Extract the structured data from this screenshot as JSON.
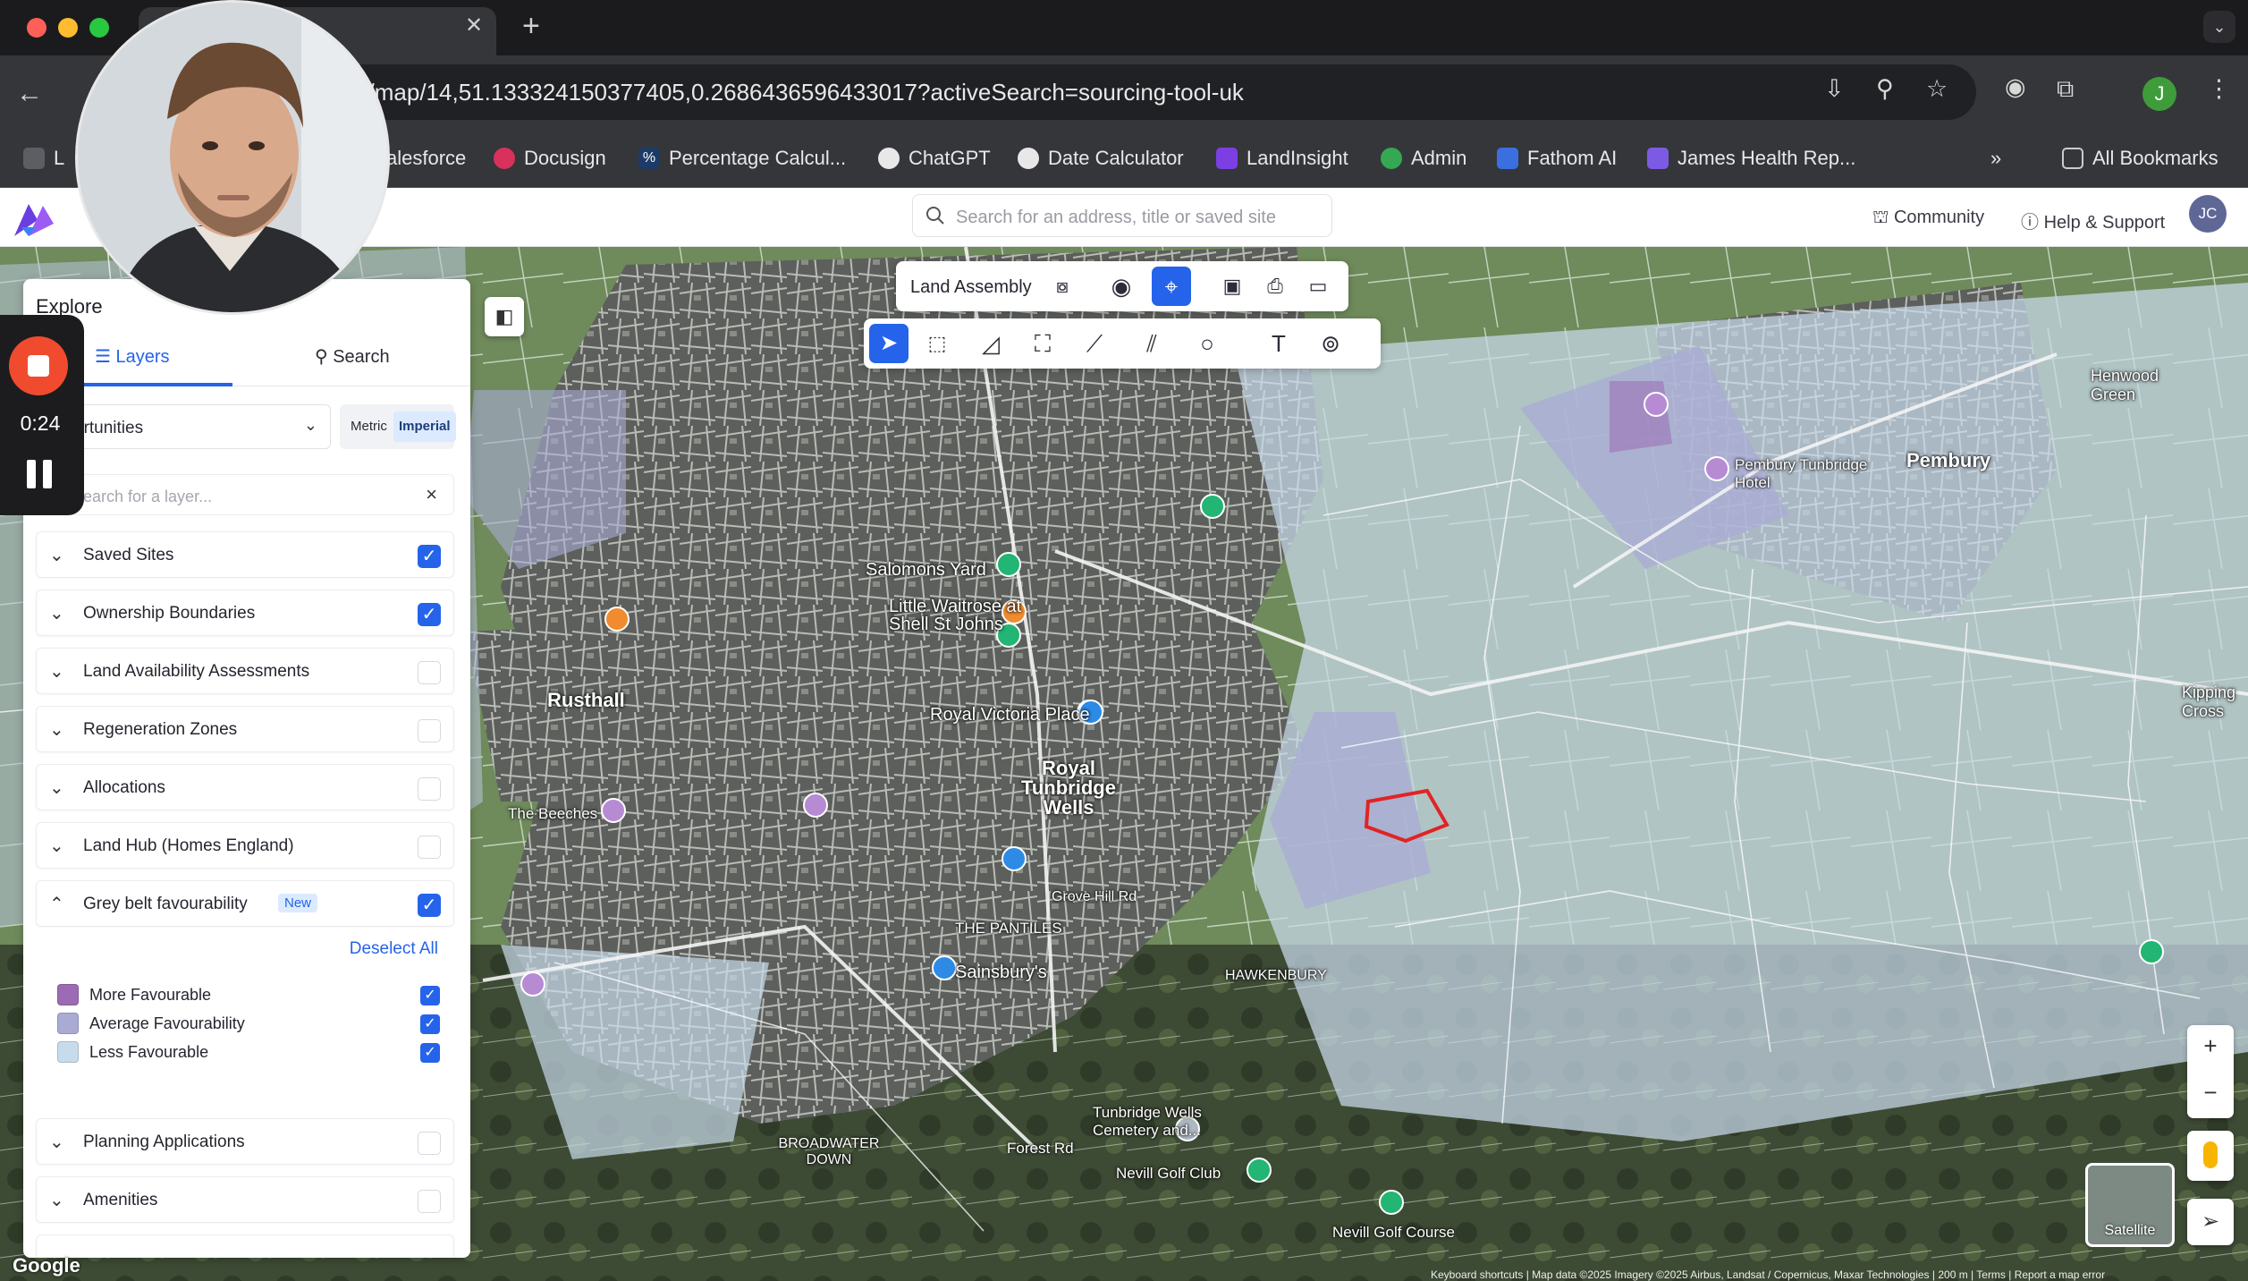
{
  "browser": {
    "url": "/landinsight/map/14,51.133324150377405,0.2686436596433017?activeSearch=sourcing-tool-uk",
    "bookmarks": [
      "L",
      "alesforce",
      "Docusign",
      "Percentage Calcul...",
      "ChatGPT",
      "Date Calculator",
      "LandInsight",
      "Admin",
      "Fathom AI",
      "James Health Rep..."
    ],
    "more_bookmarks": "»",
    "all_bookmarks": "All Bookmarks",
    "profile_initial": "J"
  },
  "header": {
    "search_placeholder": "Search for an address, title or saved site",
    "community": "Community",
    "help": "Help & Support",
    "avatar": "JC"
  },
  "toolbar": {
    "land_assembly": "Land Assembly"
  },
  "panel": {
    "title": "Explore",
    "tabs": [
      "Layers",
      "Search"
    ],
    "dropdown_value": "ortunities",
    "units": [
      "Metric",
      "Imperial"
    ],
    "layer_search_placeholder": "Search for a layer...",
    "layer_search_clear": "×",
    "layers": [
      {
        "label": "Saved Sites",
        "checked": true
      },
      {
        "label": "Ownership Boundaries",
        "checked": true
      },
      {
        "label": "Land Availability Assessments",
        "checked": false
      },
      {
        "label": "Regeneration Zones",
        "checked": false
      },
      {
        "label": "Allocations",
        "checked": false
      },
      {
        "label": "Land Hub (Homes England)",
        "checked": false
      },
      {
        "label": "Grey belt favourability",
        "checked": true,
        "badge": "New"
      },
      {
        "label": "Planning Applications",
        "checked": false
      },
      {
        "label": "Amenities",
        "checked": false
      }
    ],
    "deselect_all": "Deselect All",
    "legend": [
      {
        "label": "More Favourable",
        "color": "#9b6bb4"
      },
      {
        "label": "Average Favourability",
        "color": "#a9abd4"
      },
      {
        "label": "Less Favourable",
        "color": "#c8dbea"
      }
    ]
  },
  "recorder": {
    "time": "0:24"
  },
  "map": {
    "labels": [
      "Pembury",
      "Rusthall",
      "Royal Tunbridge Wells",
      "Royal Victoria Place",
      "Little Waitrose at Shell St Johns",
      "Sainsbury's",
      "Salomons Yard",
      "THE PANTILES",
      "BROADWATER DOWN",
      "Tunbridge Wells Cemetery and...",
      "Nevill Golf Club",
      "Nevill Golf Course",
      "Forest Rd",
      "Grove Hill Rd",
      "HAWKENBURY",
      "Henwood Green",
      "Kipping Cross",
      "Pembury Tunbridge Hotel",
      "The Beeches"
    ],
    "satellite": "Satellite",
    "google": "Google",
    "footer": "Keyboard shortcuts | Map data ©2025 Imagery ©2025 Airbus, Landsat / Copernicus, Maxar Technologies | 200 m | Terms | Report a map error"
  }
}
